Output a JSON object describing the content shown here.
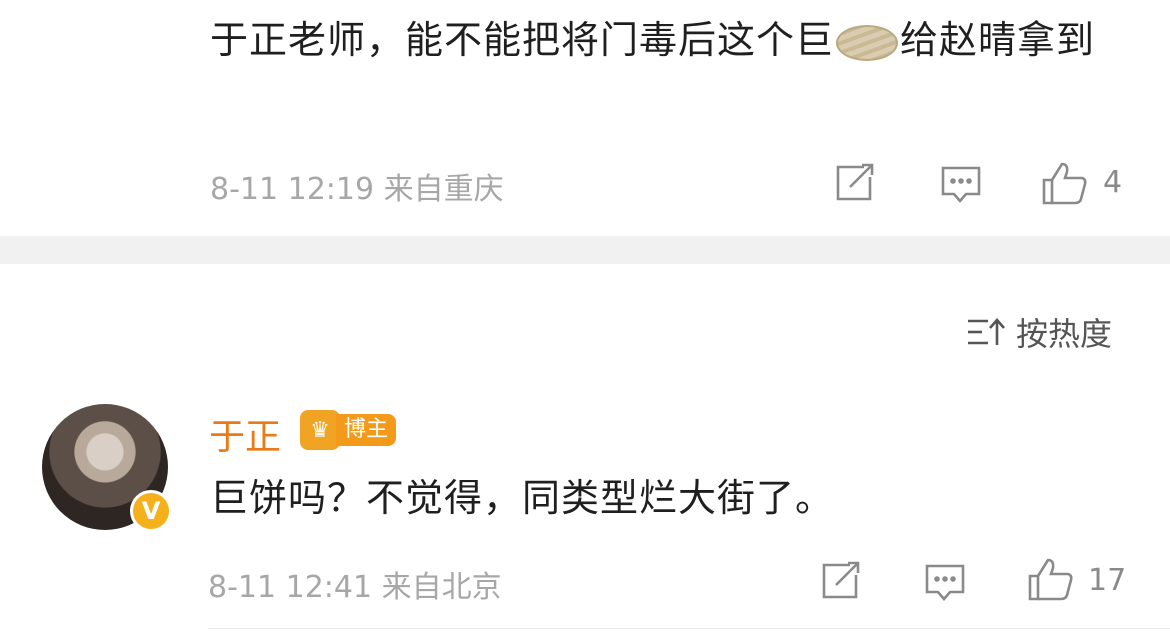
{
  "comment1": {
    "text_part1": "于正老师，能不能把将门毒后这个巨",
    "emoji": "bread-emoji",
    "text_part2": "给赵晴拿到",
    "meta": "8-11 12:19 来自重庆",
    "like_count": "4"
  },
  "sort": {
    "label": "按热度",
    "icon": "sort-icon"
  },
  "comment2": {
    "username": "于正",
    "badge_label": "博主",
    "verified": "V",
    "text": "巨饼吗？不觉得，同类型烂大街了。",
    "meta": "8-11 12:41 来自北京",
    "like_count": "17"
  },
  "colors": {
    "username": "#e87a17",
    "badge": "#f39a1a",
    "meta": "#a7a7a7"
  }
}
